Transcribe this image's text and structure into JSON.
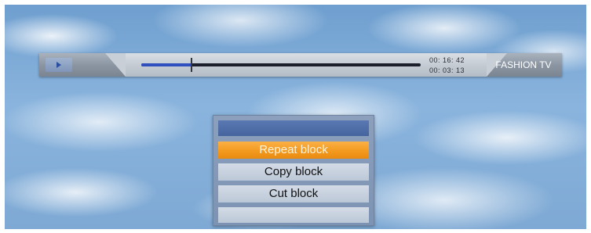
{
  "infobar": {
    "play_icon": "play-icon",
    "progress_fraction": 0.18,
    "elapsed": "00: 16: 42",
    "remaining": "00: 03: 13",
    "channel": "FASHION TV"
  },
  "menu": {
    "items": [
      {
        "label": "Repeat block",
        "selected": true
      },
      {
        "label": "Copy block",
        "selected": false
      },
      {
        "label": "Cut block",
        "selected": false
      },
      {
        "label": "",
        "selected": false
      }
    ]
  },
  "colors": {
    "accent_selected": "#f39a1f",
    "progress": "#2f4fbf"
  }
}
